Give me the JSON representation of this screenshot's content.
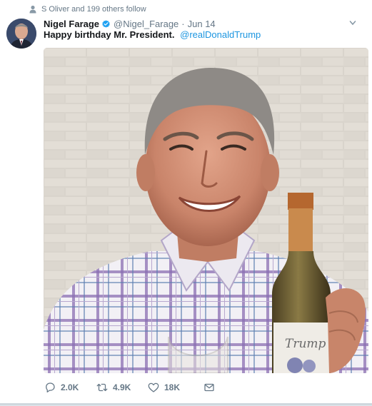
{
  "social_context": {
    "text": "S Oliver and 199 others follow",
    "icon": "person-icon"
  },
  "tweet": {
    "author": {
      "fullname": "Nigel Farage",
      "username": "@Nigel_Farage",
      "verified": true,
      "avatar_icon": "avatar"
    },
    "separator": "·",
    "timestamp": "Jun 14",
    "text": "Happy birthday Mr. President.",
    "mention": "@realDonaldTrump",
    "media": {
      "bottle_label": "Trump"
    }
  },
  "actions": {
    "reply_count": "2.0K",
    "retweet_count": "4.9K",
    "like_count": "18K"
  },
  "colors": {
    "link": "#1b95e0",
    "secondary": "#657786",
    "verified": "#1da1f2"
  }
}
